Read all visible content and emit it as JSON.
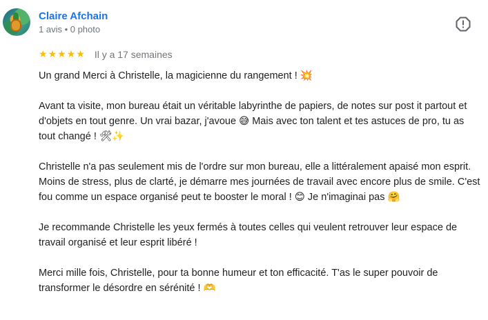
{
  "review": {
    "author": {
      "name": "Claire Afchain",
      "meta": "1 avis • 0 photo",
      "avatar_icon": "pineapple-avatar"
    },
    "report_icon": "report-flag-icon",
    "rating": 5,
    "rating_max": 5,
    "star_color": "#fbbc04",
    "date": "Il y a 17 semaines",
    "paragraphs": [
      "Un grand Merci à Christelle, la magicienne du rangement ! 💥",
      "Avant ta visite, mon bureau était un véritable labyrinthe de papiers, de notes sur post it partout et d'objets en tout genre. Un vrai bazar, j'avoue 😅 Mais avec ton talent et tes astuces de pro, tu as tout changé ! 🛠✨",
      "Christelle n'a pas seulement mis de l'ordre sur mon bureau, elle a littéralement apaisé mon esprit. Moins de stress, plus de clarté, je démarre mes journées de travail avec encore plus de smile. C'est fou comme un espace organisé peut te booster le moral ! 😊 Je n'imaginai pas 🤗",
      "Je recommande Christelle les yeux fermés à toutes celles qui veulent retrouver leur espace de travail organisé et leur esprit libéré !",
      "Merci mille fois, Christelle, pour ta bonne humeur et ton efficacité. T'as le super pouvoir de transformer le désordre en sérénité ! 🫶"
    ]
  }
}
